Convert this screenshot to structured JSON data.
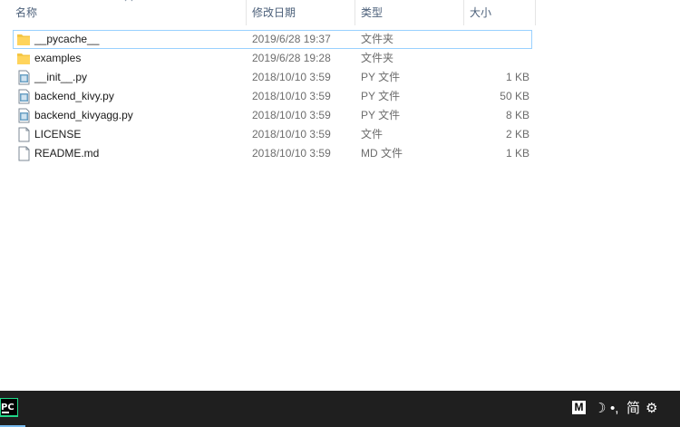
{
  "columns": {
    "name": "名称",
    "date": "修改日期",
    "type": "类型",
    "size": "大小"
  },
  "files": [
    {
      "name": "__pycache__",
      "date": "2019/6/28 19:37",
      "type": "文件夹",
      "size": "",
      "icon": "folder-icon",
      "focused": true
    },
    {
      "name": "examples",
      "date": "2019/6/28 19:28",
      "type": "文件夹",
      "size": "",
      "icon": "folder-icon"
    },
    {
      "name": "__init__.py",
      "date": "2018/10/10 3:59",
      "type": "PY 文件",
      "size": "1 KB",
      "icon": "python-file-icon"
    },
    {
      "name": "backend_kivy.py",
      "date": "2018/10/10 3:59",
      "type": "PY 文件",
      "size": "50 KB",
      "icon": "python-file-icon"
    },
    {
      "name": "backend_kivyagg.py",
      "date": "2018/10/10 3:59",
      "type": "PY 文件",
      "size": "8 KB",
      "icon": "python-file-icon"
    },
    {
      "name": "LICENSE",
      "date": "2018/10/10 3:59",
      "type": "文件",
      "size": "2 KB",
      "icon": "file-icon"
    },
    {
      "name": "README.md",
      "date": "2018/10/10 3:59",
      "type": "MD 文件",
      "size": "1 KB",
      "icon": "file-icon"
    }
  ],
  "taskbar": {
    "app_label": "PC",
    "tray": {
      "m_label": "M",
      "moon": "☽",
      "dot_comma": "•,",
      "ime": "简",
      "gear": "⚙"
    }
  },
  "colors": {
    "header_text": "#4c607a",
    "muted_text": "#6d6d6d",
    "focus_border": "#99d1ff",
    "folder": "#f5c644",
    "taskbar": "#1f1f1f"
  }
}
